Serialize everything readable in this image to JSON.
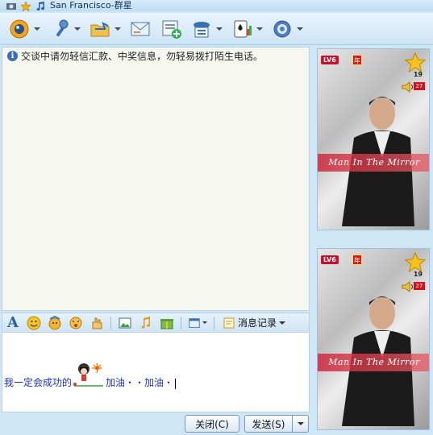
{
  "window": {
    "title": "San Francisco-群星"
  },
  "toolbar": {
    "items": [
      {
        "name": "video-call",
        "icon": "webcam-icon"
      },
      {
        "name": "voice-call",
        "icon": "microphone-icon"
      },
      {
        "name": "send-file",
        "icon": "folder-icon"
      },
      {
        "name": "message",
        "icon": "mail-icon"
      },
      {
        "name": "add-app",
        "icon": "add-app-icon"
      },
      {
        "name": "contacts",
        "icon": "address-book-icon"
      },
      {
        "name": "games",
        "icon": "game-cards-icon"
      },
      {
        "name": "settings",
        "icon": "gear-icon"
      }
    ]
  },
  "chat": {
    "notice": "交谈中请勿轻信汇款、中奖信息，勿轻易拨打陌生电话。"
  },
  "input_toolbar": {
    "history_label": "消息记录"
  },
  "input": {
    "text_before": "我一定会成功的",
    "text_after": "加油・・加油・"
  },
  "buttons": {
    "close": "关闭(C)",
    "send": "发送(S)"
  },
  "avatars": [
    {
      "level": "LV6",
      "year": "年",
      "stars": "19",
      "volume": "27",
      "banner": "Man In The Mirror"
    },
    {
      "level": "LV6",
      "year": "年",
      "stars": "19",
      "volume": "27",
      "banner": "Man In The Mirror"
    }
  ],
  "colors": {
    "accent": "#2b5ea5",
    "input_text": "#1b2fc7",
    "background": "#cfe6f7"
  }
}
